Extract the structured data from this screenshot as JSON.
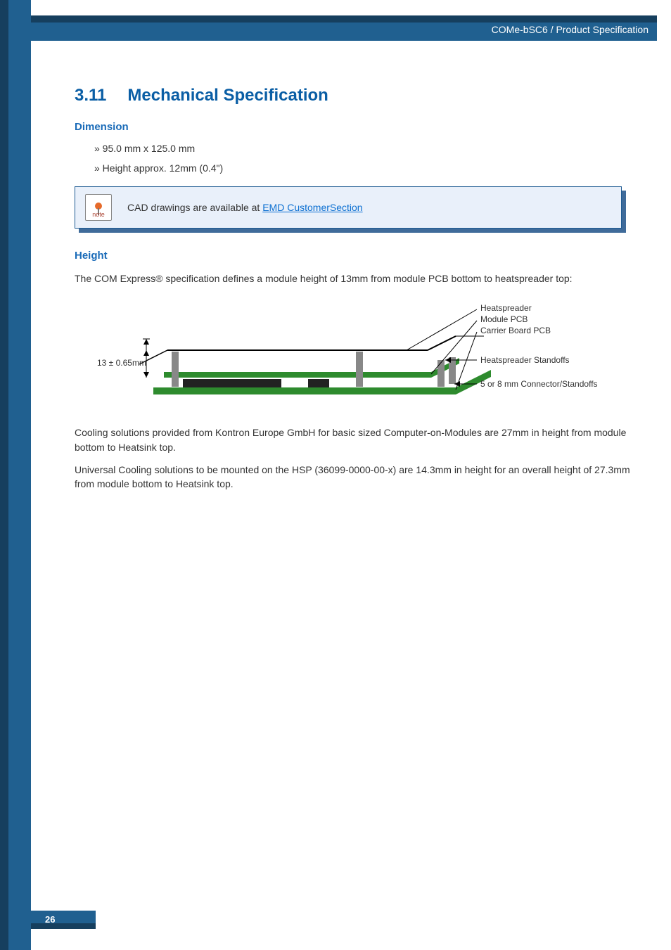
{
  "header": {
    "breadcrumb": "COMe-bSC6 / Product Specification"
  },
  "section": {
    "number": "3.11",
    "title": "Mechanical Specification"
  },
  "dimension": {
    "heading": "Dimension",
    "items": [
      "» 95.0 mm x 125.0 mm",
      "» Height approx. 12mm (0.4\")"
    ]
  },
  "note": {
    "icon_label": "note",
    "text_pre": "CAD drawings are available at ",
    "link_text": "EMD CustomerSection"
  },
  "height": {
    "heading": "Height",
    "intro": "The COM Express® specification defines a module height of 13mm from module PCB bottom to heatspreader top:",
    "diagram": {
      "dim_label": "13 ± 0.65mm",
      "labels": {
        "heatspreader": "Heatspreader",
        "module_pcb": "Module PCB",
        "carrier_pcb": "Carrier Board PCB",
        "standoffs": "Heatspreader Standoffs",
        "connector": "5 or 8 mm Connector/Standoffs"
      }
    },
    "para1": " Cooling solutions provided from Kontron Europe GmbH for basic sized Computer-on-Modules are 27mm in height from module bottom to Heatsink top.",
    "para2": "Universal Cooling solutions to be mounted on the HSP (36099-0000-00-x) are 14.3mm in height for an overall height of 27.3mm from module bottom to Heatsink top."
  },
  "footer": {
    "page": "26"
  }
}
